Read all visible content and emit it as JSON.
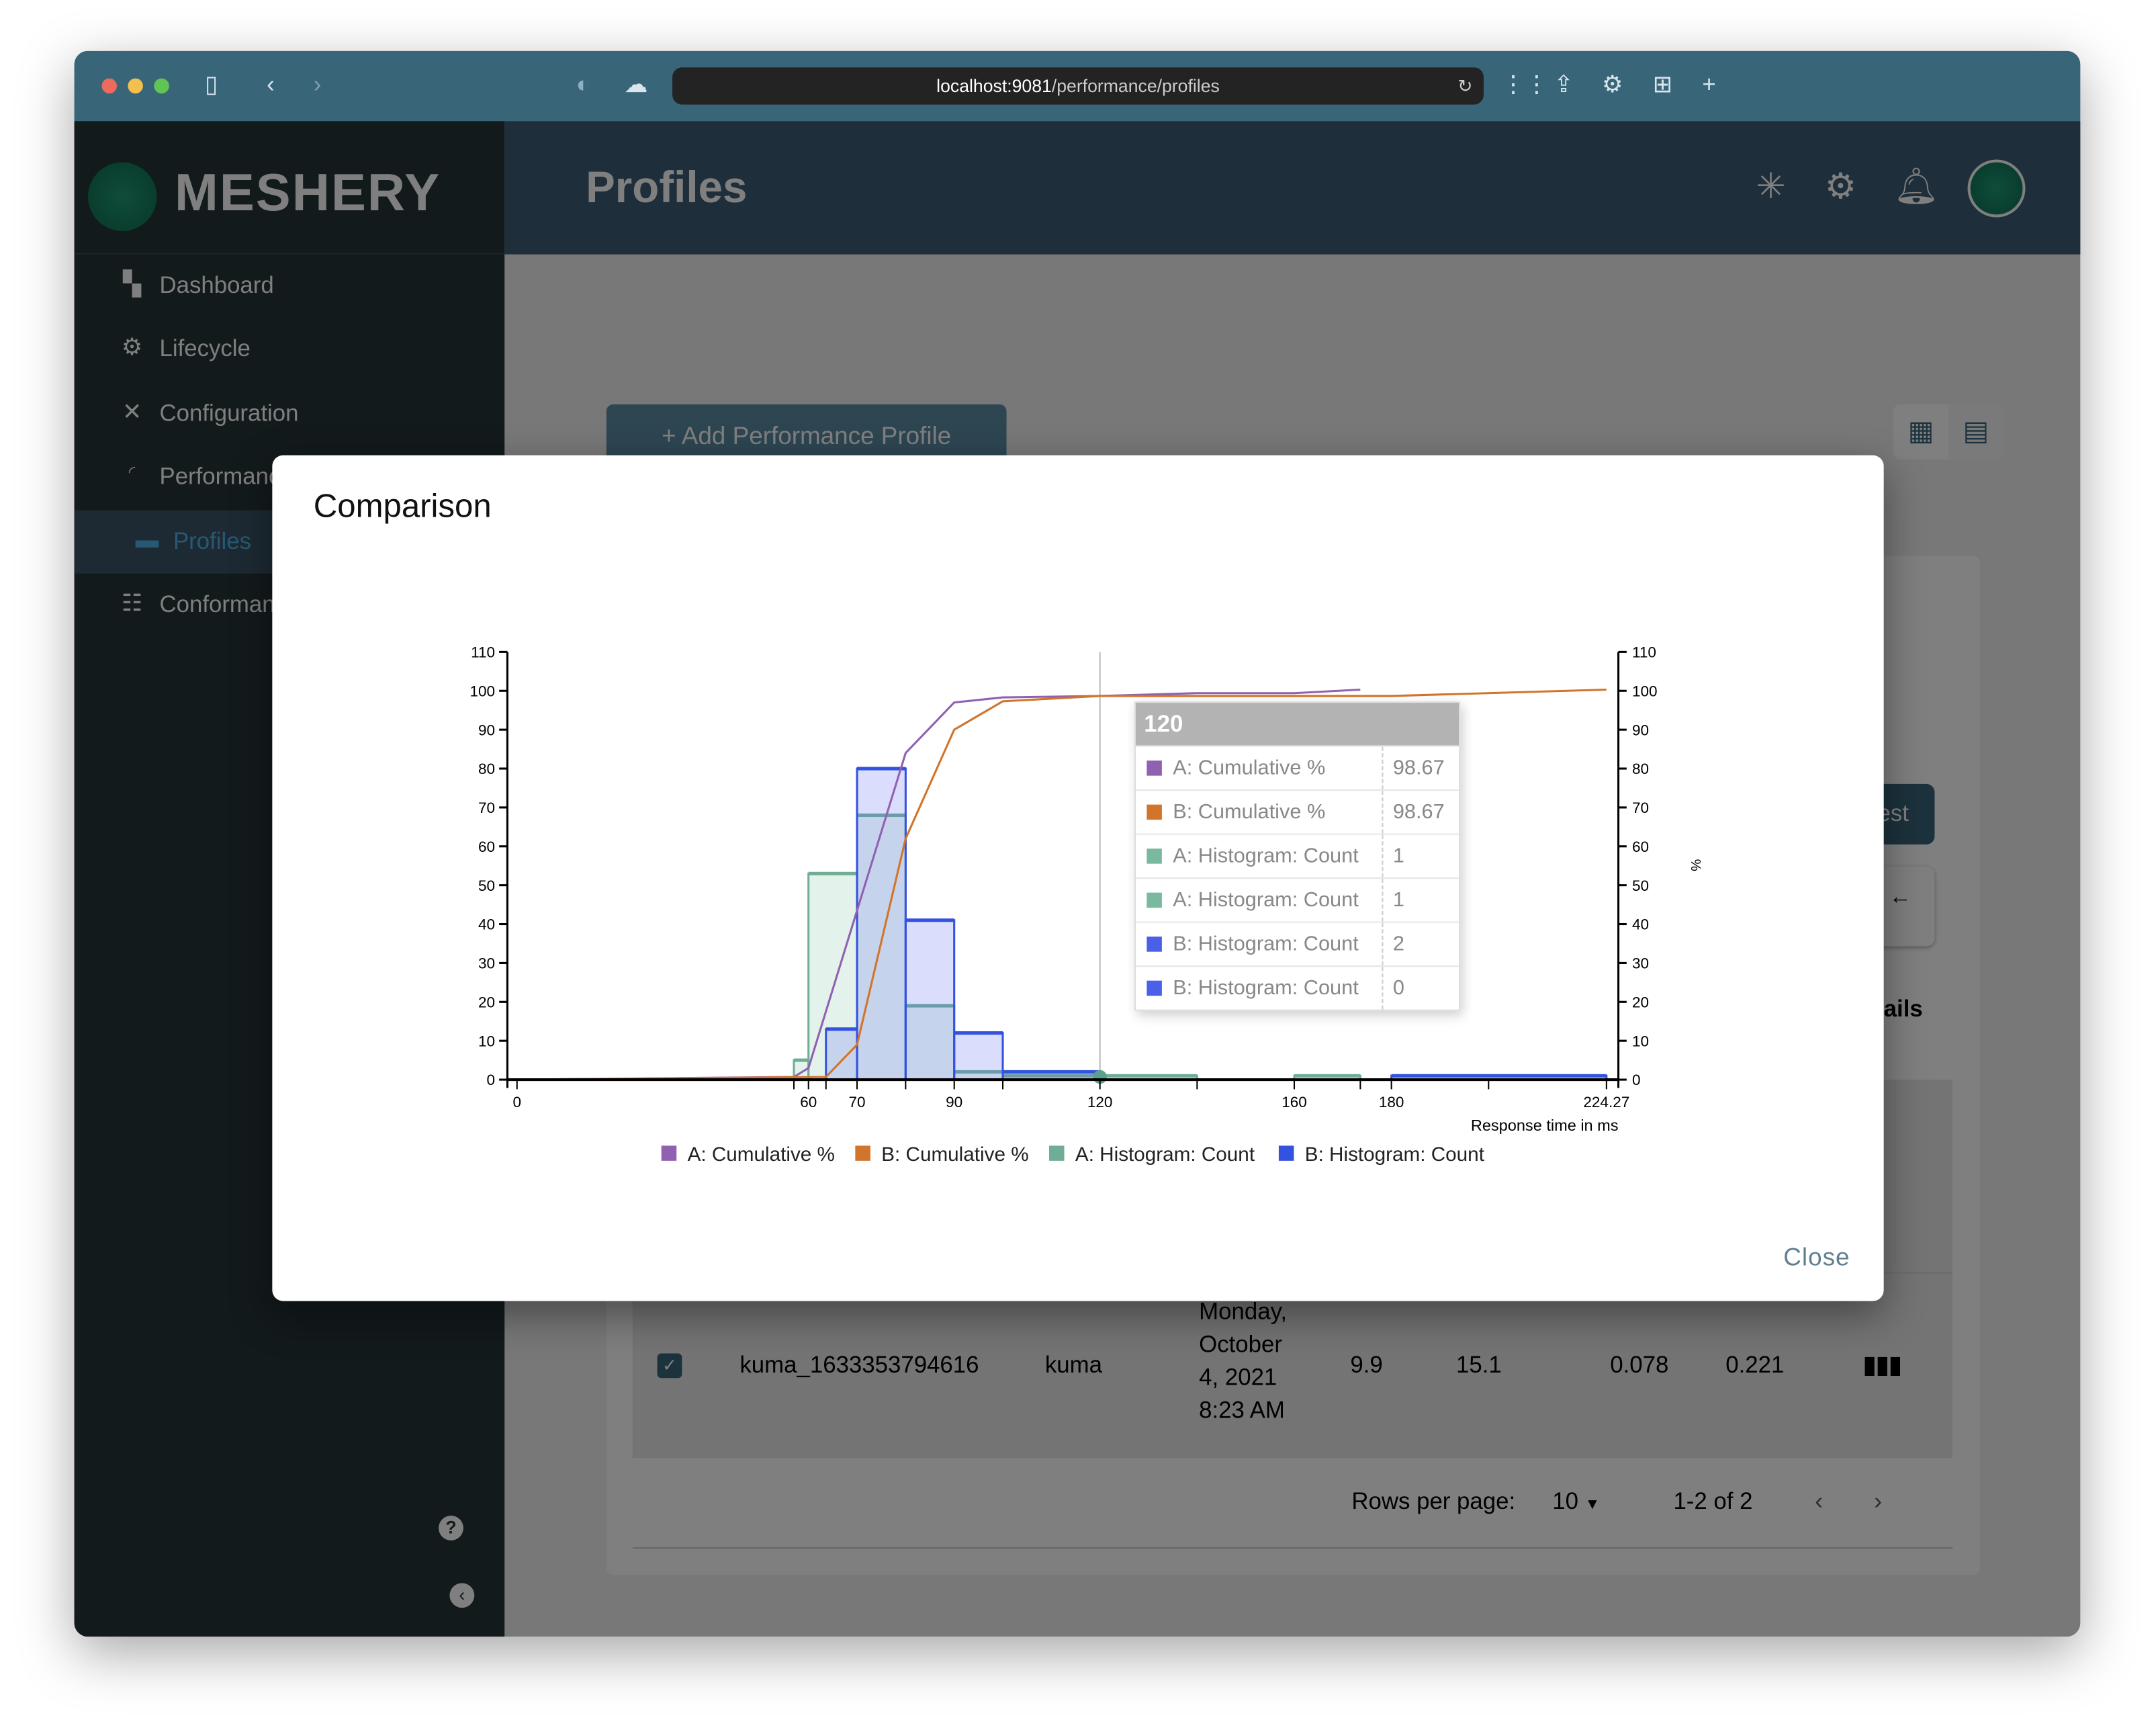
{
  "browser": {
    "url_host": "localhost:9081",
    "url_path": "/performance/profiles",
    "traffic_light_colors": [
      "#ed6a5e",
      "#f5bf4f",
      "#61c554"
    ]
  },
  "sidebar": {
    "logo_text": "MESHERY",
    "items": [
      {
        "label": "Dashboard",
        "icon": "dashboard-icon"
      },
      {
        "label": "Lifecycle",
        "icon": "gears-icon"
      },
      {
        "label": "Configuration",
        "icon": "tools-icon"
      },
      {
        "label": "Performance",
        "icon": "smp-gauge-icon"
      },
      {
        "label": "Profiles",
        "icon": "profile-card-icon",
        "selected": true
      },
      {
        "label": "Conformance",
        "icon": "checklist-icon"
      }
    ]
  },
  "header": {
    "title": "Profiles"
  },
  "page": {
    "add_button": "+ Add Performance Profile",
    "run_test_fragment": "Test",
    "details_fragment": "ails",
    "back_arrow": "←",
    "row": {
      "name": "kuma_1633353794616",
      "mesh": "kuma",
      "date_lines": [
        "Monday,",
        "October",
        "4, 2021",
        "8:23 AM"
      ],
      "qps": "9.9",
      "duration": "15.1",
      "p50": "0.078",
      "p99": "0.221"
    },
    "pagination": {
      "rows_per_page_label": "Rows per page:",
      "rows_per_page": "10",
      "range": "1-2 of 2"
    }
  },
  "modal": {
    "title": "Comparison",
    "close_label": "Close",
    "tooltip": {
      "header": "120",
      "rows": [
        {
          "label": "A: Cumulative %",
          "value": "98.67",
          "color": "#9061b0"
        },
        {
          "label": "B: Cumulative %",
          "value": "98.67",
          "color": "#d2742a"
        },
        {
          "label": "A: Histogram: Count",
          "value": "1",
          "color": "#79b9a0"
        },
        {
          "label": "A: Histogram: Count",
          "value": "1",
          "color": "#79b9a0"
        },
        {
          "label": "B: Histogram: Count",
          "value": "2",
          "color": "#4a60e8"
        },
        {
          "label": "B: Histogram: Count",
          "value": "0",
          "color": "#4a60e8"
        }
      ]
    }
  },
  "chart_data": {
    "type": "bar+line",
    "xlabel": "Response time in ms",
    "y2label": "%",
    "xlim": [
      0,
      224.27
    ],
    "ylim": [
      0,
      110
    ],
    "y_ticks": [
      0,
      10,
      20,
      30,
      40,
      50,
      60,
      70,
      80,
      90,
      100,
      110
    ],
    "x_tick_labels": [
      0,
      60,
      70,
      90,
      120,
      160,
      180,
      224.27
    ],
    "x_tick_marks": [
      0,
      57,
      60,
      63.6,
      70,
      80,
      90,
      100,
      120,
      140,
      160,
      173.6,
      180,
      200,
      224.27
    ],
    "hover_x": 120,
    "legend_position": "bottom",
    "series": [
      {
        "name": "A: Cumulative %",
        "kind": "line",
        "color": "#9061b0",
        "points": [
          [
            0,
            0
          ],
          [
            57,
            0.7
          ],
          [
            60,
            3
          ],
          [
            80,
            84
          ],
          [
            90,
            97
          ],
          [
            100,
            98.3
          ],
          [
            120,
            98.67
          ],
          [
            140,
            99.4
          ],
          [
            160,
            99.4
          ],
          [
            173.6,
            100.3
          ]
        ]
      },
      {
        "name": "B: Cumulative %",
        "kind": "line",
        "color": "#d2742a",
        "points": [
          [
            0,
            0
          ],
          [
            63.6,
            0.7
          ],
          [
            70,
            9
          ],
          [
            80,
            62
          ],
          [
            90,
            90
          ],
          [
            100,
            97.3
          ],
          [
            120,
            98.67
          ],
          [
            180,
            98.67
          ],
          [
            224.27,
            100.3
          ]
        ]
      },
      {
        "name": "A: Histogram: Count",
        "kind": "histogram",
        "color": "#6fae95",
        "bins": [
          [
            57,
            60,
            5
          ],
          [
            60,
            70,
            53
          ],
          [
            70,
            80,
            68
          ],
          [
            80,
            90,
            19
          ],
          [
            90,
            100,
            2
          ],
          [
            100,
            120,
            1
          ],
          [
            120,
            140,
            1
          ],
          [
            160,
            173.6,
            1
          ]
        ]
      },
      {
        "name": "B: Histogram: Count",
        "kind": "histogram",
        "color": "#3452e0",
        "bins": [
          [
            63.6,
            70,
            13
          ],
          [
            70,
            80,
            80
          ],
          [
            80,
            90,
            41
          ],
          [
            90,
            100,
            12
          ],
          [
            100,
            120,
            2
          ],
          [
            180,
            224.27,
            1
          ]
        ]
      }
    ]
  }
}
